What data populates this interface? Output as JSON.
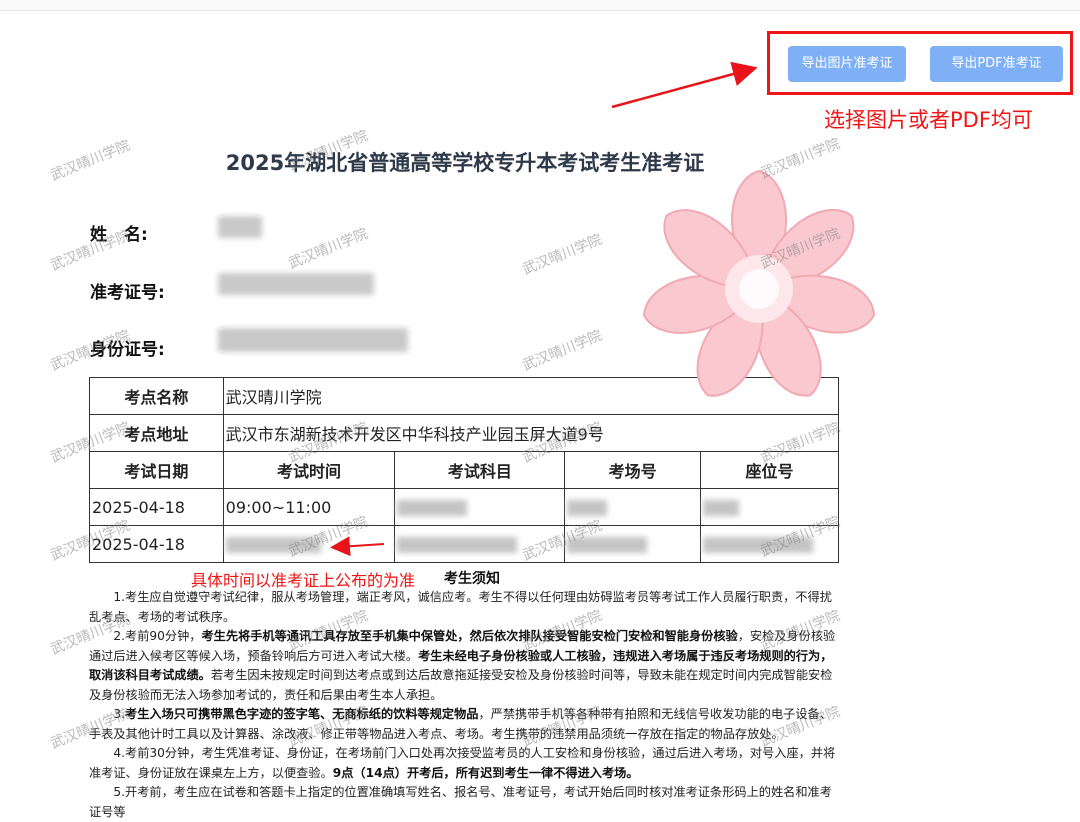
{
  "toolbar": {
    "export_image_label": "导出图片准考证",
    "export_pdf_label": "导出PDF准考证"
  },
  "annotations": {
    "export_hint": "选择图片或者PDF均可",
    "time_hint": "具体时间以准考证上公布的为准"
  },
  "watermark_text": "武汉晴川学院",
  "ticket": {
    "title": "2025年湖北省普通高等学校专升本考试考生准考证",
    "name_label": "姓　名:",
    "ticket_no_label": "准考证号:",
    "id_no_label": "身份证号:",
    "venue_name_label": "考点名称",
    "venue_name": "武汉晴川学院",
    "venue_address_label": "考点地址",
    "venue_address": "武汉市东湖新技术开发区中华科技产业园玉屏大道9号",
    "columns": [
      "考试日期",
      "考试时间",
      "考试科目",
      "考场号",
      "座位号"
    ],
    "rows": [
      {
        "date": "2025-04-18",
        "time": "09:00~11:00"
      },
      {
        "date": "2025-04-18",
        "time": ""
      }
    ]
  },
  "notice": {
    "title": "考生须知",
    "p1": "1.考生应自觉遵守考试纪律，服从考场管理，端正考风，诚信应考。考生不得以任何理由妨碍监考员等考试工作人员履行职责，不得扰乱考点、考场的考试秩序。",
    "p2_a": "2.考前90分钟，",
    "p2_b": "考生先将手机等通讯工具存放至手机集中保管处，然后依次排队接受智能安检门安检和智能身份核验",
    "p2_c": "，安检及身份核验通过后进入候考区等候入场，预备铃响后方可进入考试大楼。",
    "p2_d": "考生未经电子身份核验或人工核验，违规进入考场属于违反考场规则的行为，取消该科目考试成绩。",
    "p2_e": "若考生因未按规定时间到达考点或到达后故意拖延接受安检及身份核验时间等，导致未能在规定时间内完成智能安检及身份核验而无法入场参加考试的，责任和后果由考生本人承担。",
    "p3_a": "3.",
    "p3_b": "考生入场只可携带黑色字迹的签字笔、无商标纸的饮料等规定物品",
    "p3_c": "，严禁携带手机等各种带有拍照和无线信号收发功能的电子设备、手表及其他计时工具以及计算器、涂改液、修正带等物品进入考点、考场。考生携带的违禁用品须统一存放在指定的物品存放处。",
    "p4_a": "4.考前30分钟，考生凭准考证、身份证，在考场前门入口处再次接受监考员的人工安检和身份核验，通过后进入考场，对号入座，并将准考证、身份证放在课桌左上方，以便查验。",
    "p4_b": "9点（14点）开考后，所有迟到考生一律不得进入考场。",
    "p5": "5.开考前，考生应在试卷和答题卡上指定的位置准确填写姓名、报名号、准考证号，考试开始后同时核对准考证条形码上的姓名和准考证号等"
  },
  "colors": {
    "button_bg": "#7fb0f6",
    "annotation_red": "#f01414",
    "title_color": "#2e3a4a",
    "flower_pink": "#f9c9cf"
  },
  "icons": {
    "flower": "cherry-blossom-sticker"
  }
}
